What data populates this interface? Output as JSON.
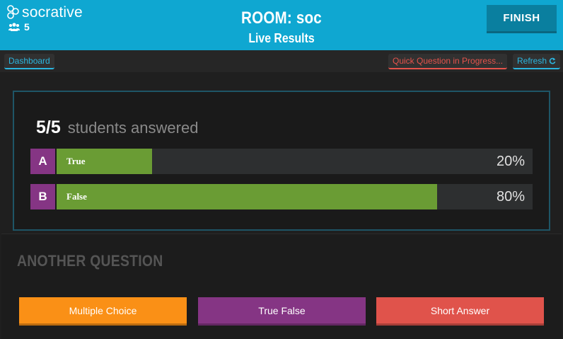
{
  "app": {
    "logo_text": "socrative",
    "student_count": "5"
  },
  "header": {
    "room_title": "ROOM: soc",
    "subtitle": "Live Results",
    "finish_label": "FINISH"
  },
  "nav": {
    "dashboard_label": "Dashboard",
    "status_label": "Quick Question in Progress...",
    "refresh_label": "Refresh",
    "refresh_icon": "refresh-icon"
  },
  "results": {
    "answered_count": "5/5",
    "answered_label": "students answered",
    "answers": [
      {
        "letter": "A",
        "label": "True",
        "percent": "20%",
        "value": 0.2
      },
      {
        "letter": "B",
        "label": "False",
        "percent": "80%",
        "value": 0.8
      }
    ]
  },
  "another": {
    "title": "ANOTHER QUESTION",
    "buttons": [
      {
        "label": "Multiple Choice",
        "color": "#fa9016"
      },
      {
        "label": "True False",
        "color": "#853584"
      },
      {
        "label": "Short Answer",
        "color": "#e0534b"
      }
    ]
  },
  "colors": {
    "header_bg": "#0fa7d1",
    "finish_bg": "#0a7f9f",
    "bar_fill": "#6a9c34",
    "letter_bg": "#853584",
    "accent_blue": "#2bb6e0",
    "accent_red": "#e5534b"
  }
}
